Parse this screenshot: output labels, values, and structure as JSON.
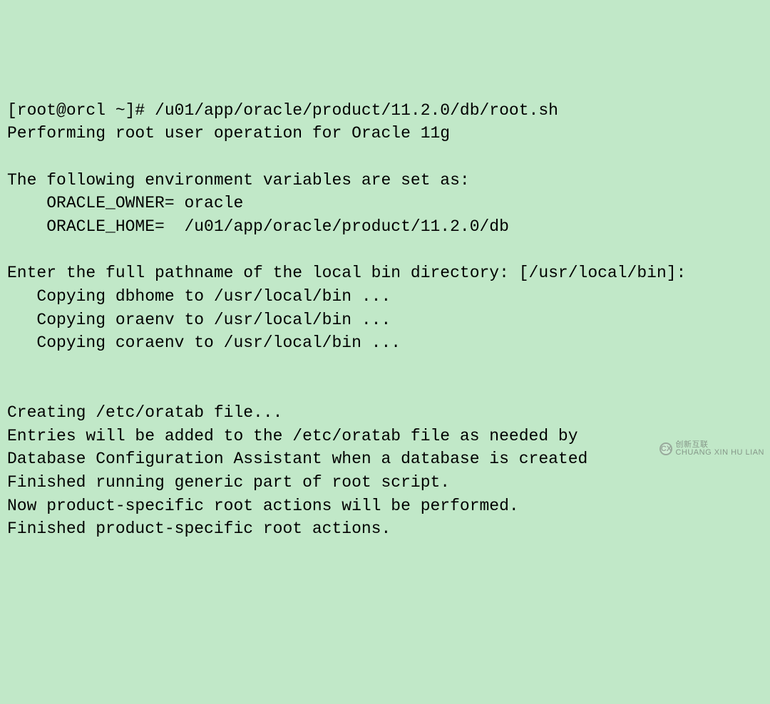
{
  "terminal": {
    "lines": [
      "[root@orcl ~]# /u01/app/oracle/product/11.2.0/db/root.sh",
      "Performing root user operation for Oracle 11g",
      "",
      "The following environment variables are set as:",
      "    ORACLE_OWNER= oracle",
      "    ORACLE_HOME=  /u01/app/oracle/product/11.2.0/db",
      "",
      "Enter the full pathname of the local bin directory: [/usr/local/bin]:",
      "   Copying dbhome to /usr/local/bin ...",
      "   Copying oraenv to /usr/local/bin ...",
      "   Copying coraenv to /usr/local/bin ...",
      "",
      "",
      "Creating /etc/oratab file...",
      "Entries will be added to the /etc/oratab file as needed by",
      "Database Configuration Assistant when a database is created",
      "Finished running generic part of root script.",
      "Now product-specific root actions will be performed.",
      "Finished product-specific root actions."
    ]
  },
  "watermark": {
    "icon_text": "CX",
    "line1": "创新互联",
    "line2": "CHUANG XIN HU LIAN"
  }
}
